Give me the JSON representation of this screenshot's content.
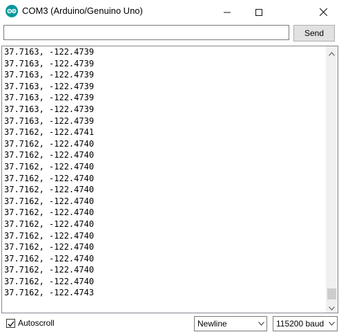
{
  "window": {
    "title": "COM3 (Arduino/Genuino Uno)",
    "app_icon": "arduino-logo-icon",
    "brand_color": "#00979c"
  },
  "send_bar": {
    "input_value": "",
    "send_label": "Send"
  },
  "output": {
    "lines": [
      "37.7163, -122.4739",
      "37.7163, -122.4739",
      "37.7163, -122.4739",
      "37.7163, -122.4739",
      "37.7163, -122.4739",
      "37.7163, -122.4739",
      "37.7163, -122.4739",
      "37.7162, -122.4741",
      "37.7162, -122.4740",
      "37.7162, -122.4740",
      "37.7162, -122.4740",
      "37.7162, -122.4740",
      "37.7162, -122.4740",
      "37.7162, -122.4740",
      "37.7162, -122.4740",
      "37.7162, -122.4740",
      "37.7162, -122.4740",
      "37.7162, -122.4740",
      "37.7162, -122.4740",
      "37.7162, -122.4740",
      "37.7162, -122.4740",
      "37.7162, -122.4743"
    ]
  },
  "footer": {
    "autoscroll_label": "Autoscroll",
    "autoscroll_checked": true,
    "line_ending": "Newline",
    "baud_rate": "115200 baud"
  }
}
